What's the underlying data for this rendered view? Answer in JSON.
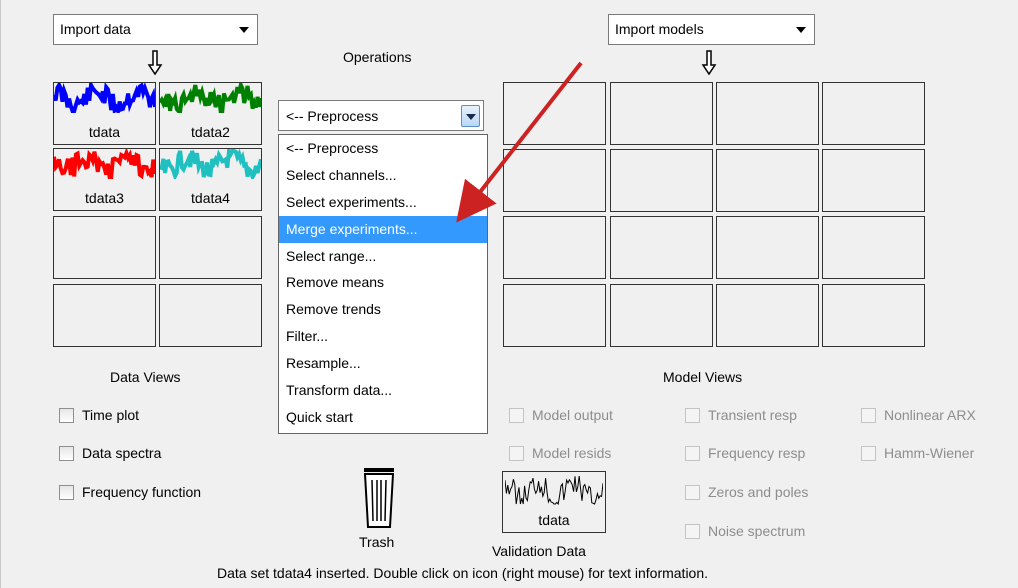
{
  "import_data": {
    "label": "Import data"
  },
  "import_models": {
    "label": "Import models"
  },
  "operations": {
    "title": "Operations",
    "selected": "<-- Preprocess",
    "options": [
      "<-- Preprocess",
      "Select channels...",
      "Select experiments...",
      "Merge experiments...",
      "Select range...",
      "Remove means",
      "Remove trends",
      "Filter...",
      "Resample...",
      "Transform data...",
      "Quick start"
    ],
    "highlighted_index": 3
  },
  "data_icons": [
    {
      "name": "tdata",
      "color": "#0000ff"
    },
    {
      "name": "tdata2",
      "color": "#008000"
    },
    {
      "name": "tdata3",
      "color": "#ff0000"
    },
    {
      "name": "tdata4",
      "color": "#20c0c0"
    }
  ],
  "data_views": {
    "title": "Data Views",
    "checkboxes": [
      "Time plot",
      "Data spectra",
      "Frequency function"
    ]
  },
  "model_views": {
    "title": "Model Views",
    "checkboxes": [
      "Model output",
      "Model resids",
      "Transient resp",
      "Frequency resp",
      "Zeros and poles",
      "Noise spectrum",
      "Nonlinear ARX",
      "Hamm-Wiener"
    ]
  },
  "trash": {
    "label": "Trash"
  },
  "validation": {
    "icon_label": "tdata",
    "label": "Validation Data"
  },
  "status": "Data set tdata4 inserted.  Double click on icon (right mouse) for text information.",
  "annotation_color": "#cc2222"
}
